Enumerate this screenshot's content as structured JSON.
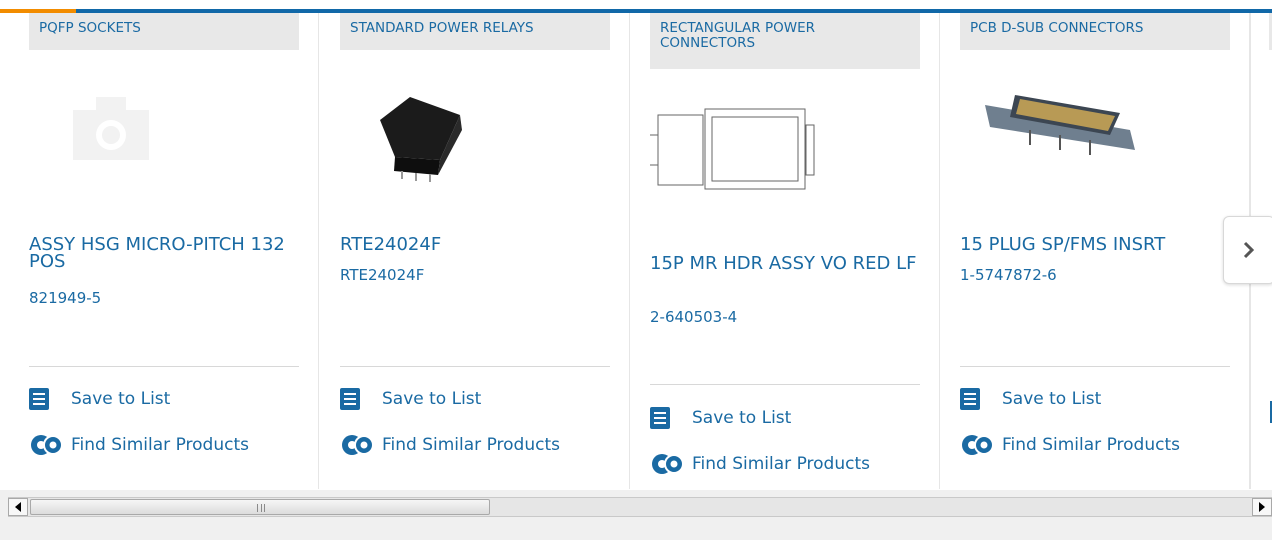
{
  "cards": [
    {
      "category": "PQFP SOCKETS",
      "title": "ASSY HSG MICRO-PITCH 132 POS",
      "part_number": "821949-5",
      "image": "placeholder-camera-icon"
    },
    {
      "category": "STANDARD POWER RELAYS",
      "title": "RTE24024F",
      "part_number": "RTE24024F",
      "image": "relay-photo"
    },
    {
      "category": "RECTANGULAR POWER CONNECTORS",
      "title": "15P MR HDR ASSY VO RED LF",
      "part_number": "2-640503-4",
      "image": "connector-drawing"
    },
    {
      "category": "PCB D-SUB CONNECTORS",
      "title": "15 PLUG SP/FMS INSRT",
      "part_number": "1-5747872-6",
      "image": "dsub-photo"
    }
  ],
  "actions": {
    "save": "Save to List",
    "similar": "Find Similar Products"
  },
  "carousel": {
    "next_icon": "chevron-right-icon"
  },
  "colors": {
    "accent": "#1a6aa3",
    "topbar": "#1168a8",
    "orange": "#f28c00"
  }
}
